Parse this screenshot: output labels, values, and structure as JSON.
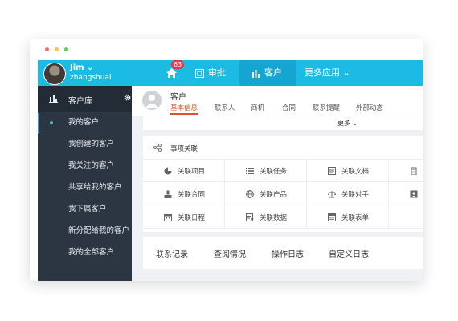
{
  "colors": {
    "accent": "#1cbbe4",
    "accent_active": "#14a5d2",
    "sidebar_bg": "#2c3643",
    "tab_active": "#e0502b",
    "dot_red": "#f26d6d",
    "dot_yellow": "#f7c24f",
    "dot_green": "#5ac75a"
  },
  "header": {
    "user_name": "Jim ⌄",
    "user_id": "zhangshuai",
    "notification_count": "63",
    "nav": [
      {
        "label": "审批",
        "icon": "approval-icon"
      },
      {
        "label": "客户",
        "icon": "customer-icon"
      },
      {
        "label": "更多应用 ⌄",
        "icon": ""
      }
    ]
  },
  "sidebar": {
    "title": "客户库",
    "items": [
      "我的客户",
      "我创建的客户",
      "我关注的客户",
      "共享给我的客户",
      "我下属客户",
      "新分配给我的客户",
      "我的全部客户"
    ]
  },
  "customer": {
    "title": "客户",
    "tabs": [
      "基本信息",
      "联系人",
      "商机",
      "合同",
      "联系提醒",
      "外部动态"
    ],
    "more_label": "更多 ⌄"
  },
  "assoc": {
    "title": "事项关联",
    "items": [
      {
        "label": "关联项目",
        "icon": "pie-icon"
      },
      {
        "label": "关联任务",
        "icon": "list-icon"
      },
      {
        "label": "关联文档",
        "icon": "document-icon"
      },
      {
        "label": "",
        "icon": "building-icon"
      },
      {
        "label": "关联合同",
        "icon": "stamp-icon"
      },
      {
        "label": "关联产品",
        "icon": "globe-icon"
      },
      {
        "label": "关联对手",
        "icon": "scale-icon"
      },
      {
        "label": "",
        "icon": "contact-card-icon"
      },
      {
        "label": "关联日程",
        "icon": "calendar-icon"
      },
      {
        "label": "关联数据",
        "icon": "data-icon"
      },
      {
        "label": "关联表单",
        "icon": "form-icon"
      }
    ]
  },
  "bottom_tabs": [
    "联系记录",
    "查阅情况",
    "操作日志",
    "自定义日志"
  ]
}
